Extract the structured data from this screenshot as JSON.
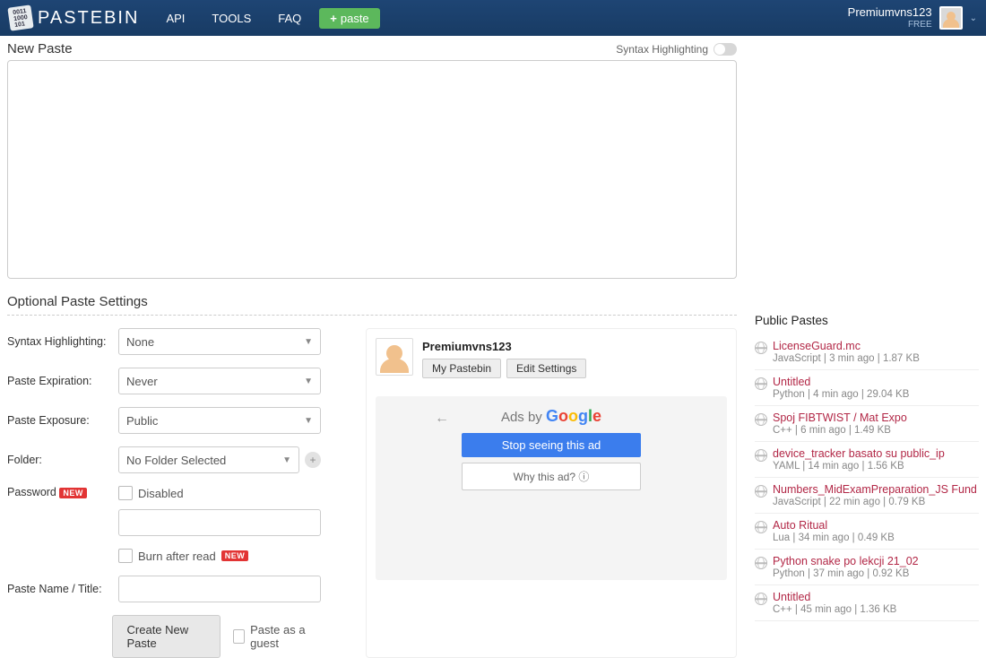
{
  "header": {
    "brand": "PASTEBIN",
    "nav": {
      "api": "API",
      "tools": "TOOLS",
      "faq": "FAQ"
    },
    "paste_btn": "paste",
    "user": {
      "name": "Premiumvns123",
      "plan": "FREE"
    }
  },
  "new_paste": {
    "heading": "New Paste",
    "syntax_label": "Syntax Highlighting"
  },
  "settings": {
    "heading": "Optional Paste Settings",
    "labels": {
      "syntax": "Syntax Highlighting:",
      "expiration": "Paste Expiration:",
      "exposure": "Paste Exposure:",
      "folder": "Folder:",
      "password": "Password",
      "name": "Paste Name / Title:"
    },
    "values": {
      "syntax": "None",
      "expiration": "Never",
      "exposure": "Public",
      "folder": "No Folder Selected",
      "disabled": "Disabled",
      "burn": "Burn after read"
    },
    "new_badge": "NEW",
    "create_btn": "Create New Paste",
    "guest": "Paste as a guest"
  },
  "user_card": {
    "name": "Premiumvns123",
    "my_pastebin": "My Pastebin",
    "edit_settings": "Edit Settings"
  },
  "ad": {
    "title_prefix": "Ads by ",
    "stop": "Stop seeing this ad",
    "why": "Why this ad? ⓘ"
  },
  "right": {
    "heading": "Public Pastes",
    "items": [
      {
        "title": "LicenseGuard.mc",
        "meta": "JavaScript | 3 min ago | 1.87 KB"
      },
      {
        "title": "Untitled",
        "meta": "Python | 4 min ago | 29.04 KB"
      },
      {
        "title": "Spoj FIBTWIST / Mat Expo",
        "meta": "C++ | 6 min ago | 1.49 KB"
      },
      {
        "title": "device_tracker basato su public_ip",
        "meta": "YAML | 14 min ago | 1.56 KB"
      },
      {
        "title": "Numbers_MidExamPreparation_JS Fund",
        "meta": "JavaScript | 22 min ago | 0.79 KB"
      },
      {
        "title": "Auto Ritual",
        "meta": "Lua | 34 min ago | 0.49 KB"
      },
      {
        "title": "Python snake po lekcji 21_02",
        "meta": "Python | 37 min ago | 0.92 KB"
      },
      {
        "title": "Untitled",
        "meta": "C++ | 45 min ago | 1.36 KB"
      }
    ]
  }
}
